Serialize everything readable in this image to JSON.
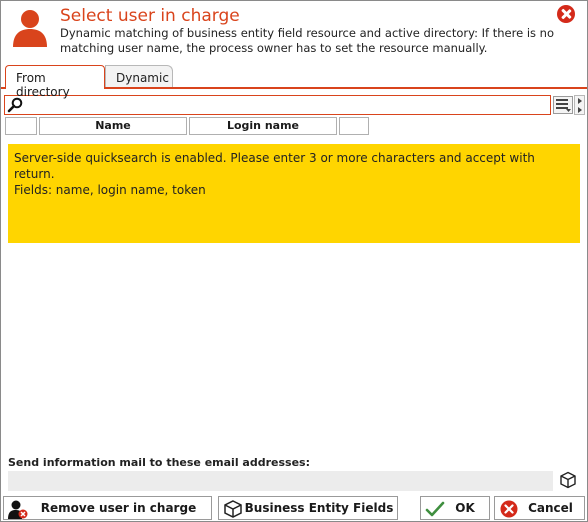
{
  "dialog": {
    "title": "Select user in charge",
    "subtitle": "Dynamic matching of business entity field resource and active directory: If there is no matching user name, the process owner has to set the resource manually."
  },
  "tabs": [
    {
      "label": "From directory",
      "active": true
    },
    {
      "label": "Dynamic",
      "active": false
    }
  ],
  "search": {
    "value": "",
    "placeholder": ""
  },
  "table": {
    "columns": [
      "",
      "Name",
      "Login name",
      ""
    ]
  },
  "notice": {
    "line1": "Server-side quicksearch is enabled. Please enter 3 or more characters and accept with return.",
    "line2": "Fields: name, login name, token",
    "color": "#ffd500"
  },
  "mail": {
    "label": "Send information mail to these email addresses:",
    "value": ""
  },
  "buttons": {
    "remove_user": "Remove user in charge",
    "business_entity_fields": "Business Entity Fields",
    "ok": "OK",
    "cancel": "Cancel"
  },
  "colors": {
    "accent": "#d9441c",
    "close": "#d42a1a",
    "ok_check": "#3f8f3f"
  }
}
